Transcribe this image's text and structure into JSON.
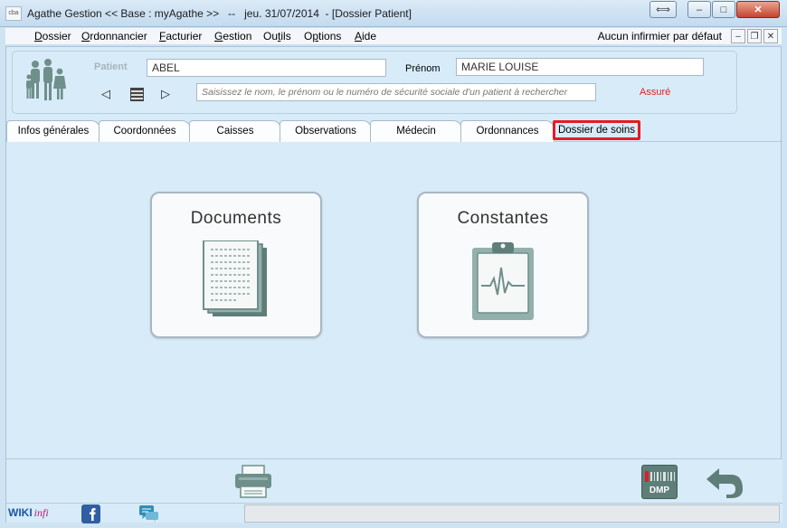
{
  "window": {
    "icon_text": "cba",
    "title": "Agathe Gestion << Base : myAgathe >>   --   jeu. 31/07/2014  - [Dossier Patient]",
    "controls": {
      "extra": "⟺",
      "minimize": "–",
      "maximize": "□",
      "close": "✕"
    }
  },
  "menu": {
    "items": [
      {
        "label": "Dossier",
        "underline": "D"
      },
      {
        "label": "Ordonnancier",
        "underline": "O"
      },
      {
        "label": "Facturier",
        "underline": "F"
      },
      {
        "label": "Gestion",
        "underline": "G"
      },
      {
        "label": "Outils",
        "underline": "t"
      },
      {
        "label": "Options",
        "underline": "p"
      },
      {
        "label": "Aide",
        "underline": "A"
      }
    ],
    "right_text": "Aucun infirmier par défaut",
    "mdi": {
      "minimize": "–",
      "restore": "❐",
      "close": "✕"
    }
  },
  "patient": {
    "label": "Patient",
    "name_value": "ABEL",
    "prenom_label": "Prénom",
    "prenom_value": "MARIE LOUISE",
    "search_placeholder": "Saisissez le nom, le prénom ou le numéro de sécurité sociale d'un patient à rechercher",
    "status": "Assuré",
    "nav": {
      "prev": "◁",
      "next": "▷"
    }
  },
  "tabs": [
    {
      "label": "Infos générales",
      "active": false
    },
    {
      "label": "Coordonnées",
      "active": false
    },
    {
      "label": "Caisses",
      "active": false
    },
    {
      "label": "Observations",
      "active": false
    },
    {
      "label": "Médecin",
      "active": false
    },
    {
      "label": "Ordonnances",
      "active": false
    },
    {
      "label": "Dossier de soins",
      "active": true
    }
  ],
  "cards": {
    "documents": "Documents",
    "constantes": "Constantes"
  },
  "footer": {
    "wiki": "WIKI",
    "wiki_suffix": "infi",
    "dmp": "DMP"
  },
  "colors": {
    "accent_red": "#e41b25",
    "icon_teal": "#6f8f8a",
    "background": "#d7ebf8"
  }
}
